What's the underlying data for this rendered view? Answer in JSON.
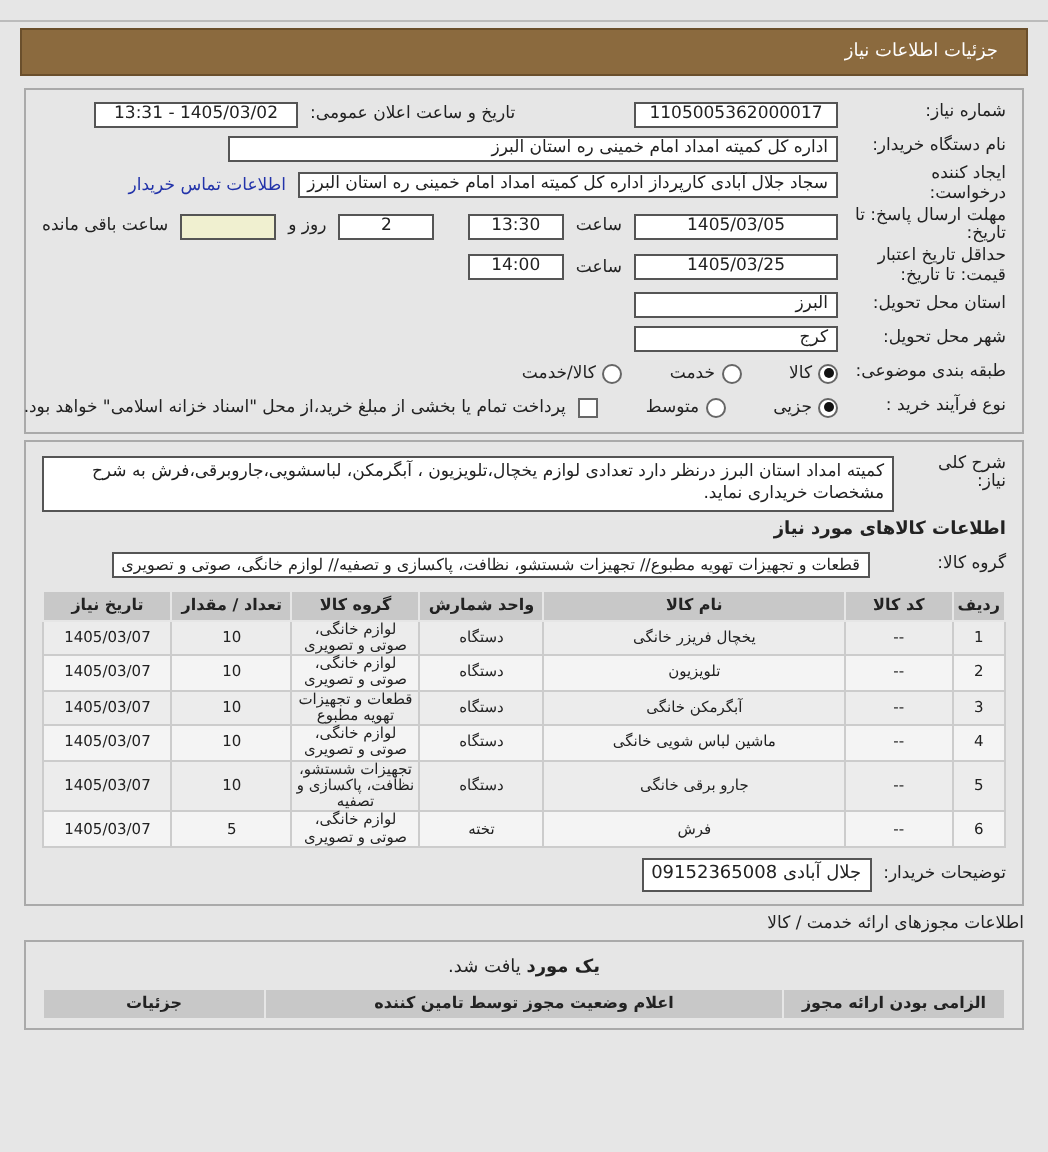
{
  "header": {
    "title": "جزئیات اطلاعات نیاز"
  },
  "need_info": {
    "need_number": {
      "label": "شماره نیاز:",
      "value": "1105005362000017"
    },
    "announce": {
      "label": "تاریخ و ساعت اعلان عمومی:",
      "value": "1405/03/02 - 13:31"
    },
    "buyer": {
      "label": "نام دستگاه خریدار:",
      "value": "اداره کل کمیته امداد امام خمینی  ره  استان البرز"
    },
    "requester": {
      "label": "ایجاد کننده درخواست:",
      "value": "سجاد جلال آبادی کارپرداز اداره کل کمیته امداد امام خمینی  ره  استان البرز",
      "link": "اطلاعات تماس خریدار"
    },
    "deadline": {
      "label": "مهلت ارسال پاسخ: تا تاریخ:",
      "date": "1405/03/05",
      "time_label": "ساعت",
      "time": "13:30",
      "days": "2",
      "days_label": "روز و",
      "remaining_label": "ساعت باقی مانده"
    },
    "validity": {
      "label": "حداقل تاریخ اعتبار قیمت: تا تاریخ:",
      "date": "1405/03/25",
      "time_label": "ساعت",
      "time": "14:00"
    },
    "province": {
      "label": "استان محل تحویل:",
      "value": "البرز"
    },
    "city": {
      "label": "شهر محل تحویل:",
      "value": "کرج"
    },
    "category": {
      "label": "طبقه بندی موضوعی:",
      "options": [
        {
          "label": "کالا",
          "selected": true
        },
        {
          "label": "خدمت",
          "selected": false
        },
        {
          "label": "کالا/خدمت",
          "selected": false
        }
      ]
    },
    "process": {
      "label": "نوع فرآیند خرید :",
      "options": [
        {
          "label": "جزیی",
          "selected": true
        },
        {
          "label": "متوسط",
          "selected": false
        }
      ],
      "payment": {
        "label": "پرداخت تمام یا بخشی از مبلغ خرید،از محل \"اسناد خزانه اسلامی\" خواهد بود.",
        "checked": false
      }
    }
  },
  "goods": {
    "description": {
      "label": "شرح کلی نیاز:",
      "value": "کمیته امداد استان البرز درنظر دارد تعدادی لوازم یخچال،تلویزیون ، آبگرمکن، لباسشویی،جاروبرقی،فرش به شرح مشخصات خریداری نماید."
    },
    "title": "اطلاعات کالاهای مورد نیاز",
    "group": {
      "label": "گروه کالا:",
      "value": "قطعات و تجهیزات تهویه مطبوع// تجهیزات شستشو، نظافت، پاکسازی و تصفیه// لوازم خانگی، صوتی و تصویری"
    },
    "table": {
      "columns": [
        "ردیف",
        "کد کالا",
        "نام کالا",
        "واحد شمارش",
        "گروه کالا",
        "تعداد / مقدار",
        "تاریخ نیاز"
      ],
      "rows": [
        [
          "1",
          "--",
          "یخچال فریزر خانگی",
          "دستگاه",
          "لوازم خانگی، صوتی و تصویری",
          "10",
          "1405/03/07"
        ],
        [
          "2",
          "--",
          "تلویزیون",
          "دستگاه",
          "لوازم خانگی، صوتی و تصویری",
          "10",
          "1405/03/07"
        ],
        [
          "3",
          "--",
          "آبگرمکن خانگی",
          "دستگاه",
          "قطعات و تجهیزات تهویه مطبوع",
          "10",
          "1405/03/07"
        ],
        [
          "4",
          "--",
          "ماشین لباس شویی خانگی",
          "دستگاه",
          "لوازم خانگی، صوتی و تصویری",
          "10",
          "1405/03/07"
        ],
        [
          "5",
          "--",
          "جارو برقی خانگی",
          "دستگاه",
          "تجهیزات شستشو، نظافت، پاکسازی و تصفیه",
          "10",
          "1405/03/07"
        ],
        [
          "6",
          "--",
          "فرش",
          "تخته",
          "لوازم خانگی، صوتی و تصویری",
          "5",
          "1405/03/07"
        ]
      ]
    },
    "buyer_notes": {
      "label": "توضیحات خریدار:",
      "value": "جلال آبادی 09152365008"
    }
  },
  "licenses": {
    "title": "اطلاعات مجوزهای ارائه خدمت / کالا",
    "found": "**یک مورد** یافت شد.",
    "columns": [
      "الزامی بودن ارائه مجوز",
      "اعلام وضعیت مجوز توسط تامین کننده",
      "جزئیات"
    ]
  }
}
